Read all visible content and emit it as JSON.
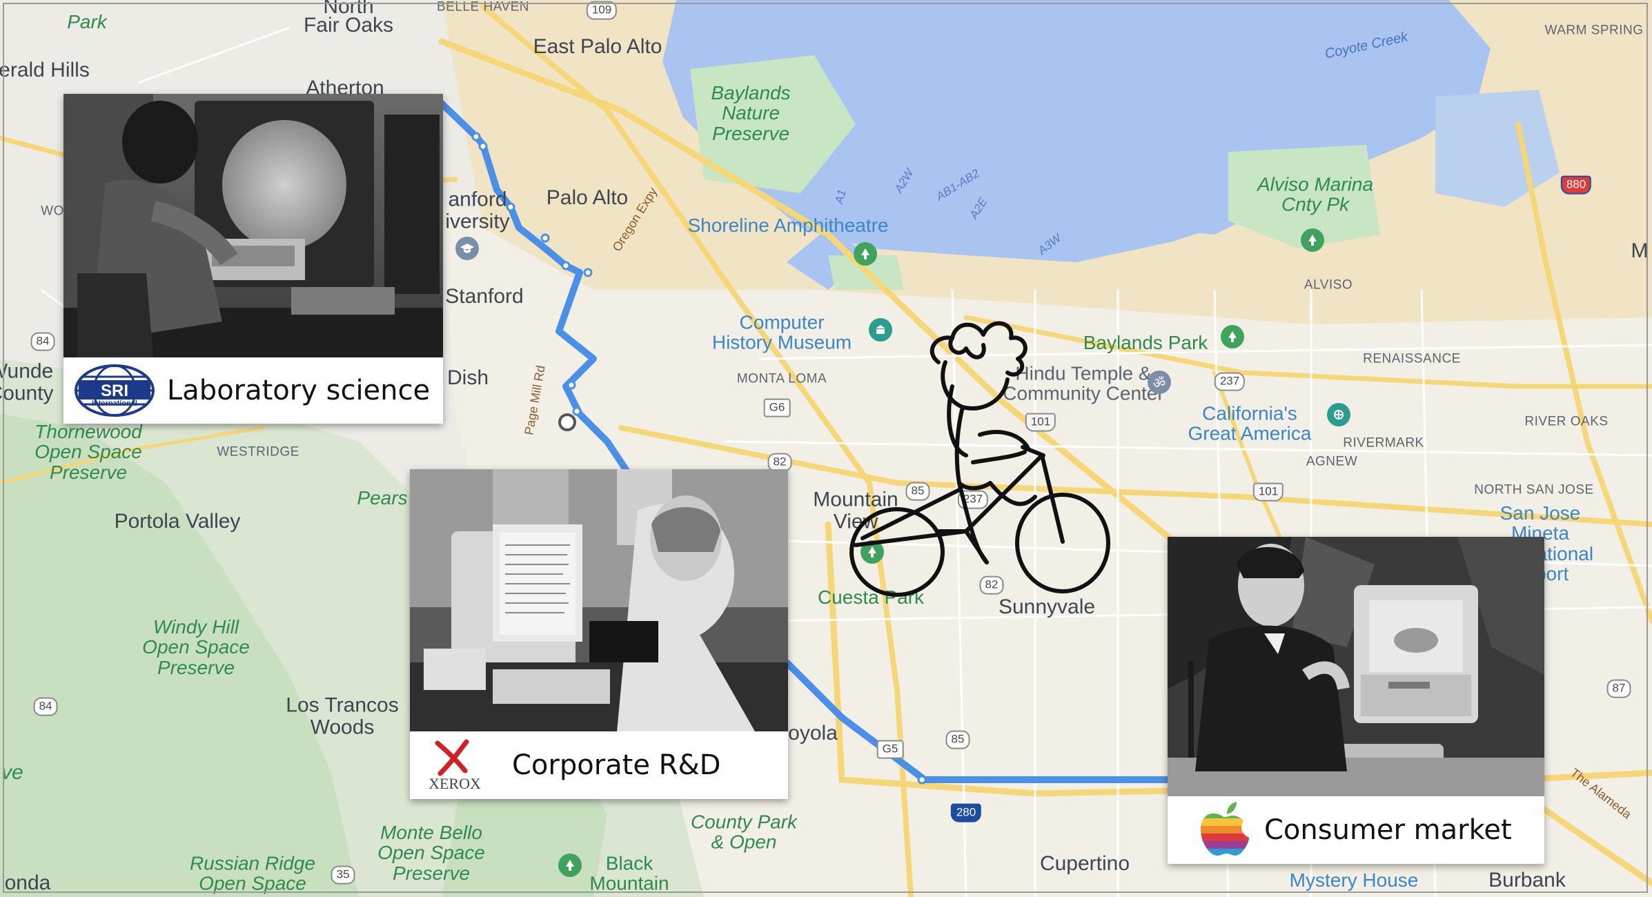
{
  "map": {
    "places": [
      {
        "name": "Fair Oaks"
      },
      {
        "name": "East Palo Alto"
      },
      {
        "name": "erald Hills"
      },
      {
        "name": "Atherton"
      },
      {
        "name": "Palo Alto"
      },
      {
        "name": "anford\niversity"
      },
      {
        "name": "Stanford"
      },
      {
        "name": "Dish"
      },
      {
        "name": "Portola Valley"
      },
      {
        "name": "Los Trancos\nWoods"
      },
      {
        "name": "Mountain\nView"
      },
      {
        "name": "Sunnyvale"
      },
      {
        "name": "Cupertino"
      },
      {
        "name": "Burbank"
      },
      {
        "name": "Wunde\nCounty"
      },
      {
        "name": "oyola"
      },
      {
        "name": "Pears"
      }
    ],
    "small_places": [
      {
        "name": "MONTA LOMA"
      },
      {
        "name": "WESTRIDGE"
      },
      {
        "name": "ALVISO"
      },
      {
        "name": "RENAISSANCE"
      },
      {
        "name": "RIVERMARK"
      },
      {
        "name": "AGNEW"
      },
      {
        "name": "RIVER OAKS"
      },
      {
        "name": "NORTH SAN JOSE"
      },
      {
        "name": "WARM SPRING"
      },
      {
        "name": "BELLE HAVEN"
      },
      {
        "name": "North"
      },
      {
        "name": "WO"
      },
      {
        "name": "M"
      }
    ],
    "parks": [
      {
        "name": "Baylands\nNature\nPreserve"
      },
      {
        "name": "Alviso Marina\nCnty Pk"
      },
      {
        "name": "Baylands Park"
      },
      {
        "name": "Thornewood\nOpen Space\nPreserve"
      },
      {
        "name": "Windy Hill\nOpen Space\nPreserve"
      },
      {
        "name": "Monte Bello\nOpen Space\nPreserve"
      },
      {
        "name": "Russian Ridge\nOpen Space"
      },
      {
        "name": "Black\nMountain"
      },
      {
        "name": "County Park\n& Open"
      },
      {
        "name": "Cuesta Park"
      },
      {
        "name": "Park"
      },
      {
        "name": "California's\nGreat America"
      }
    ],
    "pois": [
      {
        "name": "Shoreline Amphitheatre"
      },
      {
        "name": "Computer\nHistory Museum"
      },
      {
        "name": "Hindu Temple &\nCommunity Center"
      },
      {
        "name": "San Jose\nMineta\nInternational\nAirport"
      },
      {
        "name": "Mystery House"
      }
    ],
    "water_labels": [
      {
        "name": "Coyote Creek"
      }
    ],
    "road_labels": [
      {
        "name": "Oregon Expy"
      },
      {
        "name": "Page Mill Rd"
      },
      {
        "name": "The Alameda"
      }
    ],
    "shields": [
      {
        "name": "109"
      },
      {
        "name": "84"
      },
      {
        "name": "84"
      },
      {
        "name": "35"
      },
      {
        "name": "82"
      },
      {
        "name": "82"
      },
      {
        "name": "85"
      },
      {
        "name": "85"
      },
      {
        "name": "237"
      },
      {
        "name": "237"
      },
      {
        "name": "101"
      },
      {
        "name": "101"
      },
      {
        "name": "880"
      },
      {
        "name": "280"
      },
      {
        "name": "87"
      },
      {
        "name": "G6"
      },
      {
        "name": "G5"
      }
    ],
    "bay_lanes": [
      "A1",
      "A2W",
      "AB1-AB2",
      "A2E",
      "A3W"
    ],
    "partial_left": [
      "ve",
      "onda"
    ]
  },
  "cards": {
    "sri": {
      "caption": "Laboratory science",
      "logo_text": "SRI",
      "logo_subtext": "International"
    },
    "xerox": {
      "caption": "Corporate R&D",
      "logo_text": "XEROX"
    },
    "apple": {
      "caption": "Consumer market"
    }
  },
  "colors": {
    "route": "#4a8fe8",
    "water": "#a9c4f0",
    "land": "#ecebe6",
    "park": "#c8e6c4",
    "urban": "#f4eedb",
    "road": "#f6d778"
  },
  "icons": [
    "person-on-bicycle-icon",
    "apple-rainbow-logo-icon",
    "sri-globe-logo-icon",
    "xerox-x-logo-icon",
    "tree-icon",
    "museum-icon",
    "graduation-cap-icon",
    "temple-icon",
    "theme-park-icon"
  ]
}
